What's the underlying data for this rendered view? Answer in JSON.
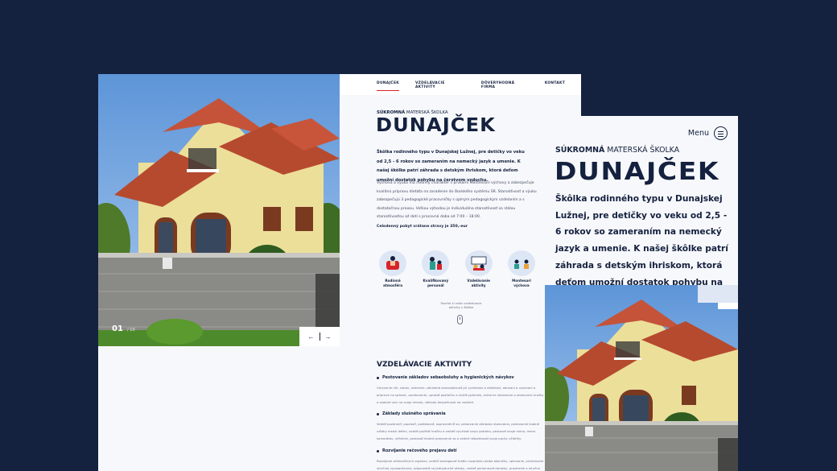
{
  "desktop": {
    "nav": [
      "DUNAJČEK",
      "VZDELÁVACIE AKTIVITY",
      "DÔVERYHODNÁ FIRMA",
      "KONTAKT"
    ],
    "slider": {
      "current": "01",
      "total": "/ 10"
    },
    "subtitle_bold": "SÚKROMNÁ",
    "subtitle_rest": " MATERSKÁ ŠKOLKA",
    "title": "DUNAJČEK",
    "lead": "Škôlka rodinného typu v Dunajskej Lužnej, pre detičky vo veku od 2,5 - 6 rokov so zameraním na nemecký jazyk a umenie. K našej škôlke patrí záhrada s detským ihriskom, ktorá deťom umožní dostatok pohybu na čerstvom vzduchu.",
    "body": "Výchova a výuka má rodinný charakter s prvkami Montessori výchovy a zabezpečuje kvalitnú prípravu dieťaťa na zaradenie do školského systému SR. Starostlivosť a výuku zabezpečujú 3 pedagogické pracovníčky s úplným pedagogickým vzdelaním a s dostatočnou praxou. Veľkou výhodou je individuálna starostlivosť so stálou starostlivosťou až deti s pracovná doba od 7:00 – 18:00.",
    "price": "Celodenný pobyt vrátane stravy je 350,-eur",
    "features": [
      {
        "icon": "armchair-child-icon",
        "label": "Rodinná atmosféra"
      },
      {
        "icon": "teacher-child-icon",
        "label": "Kvalifikovaný personál"
      },
      {
        "icon": "classroom-icon",
        "label": "Vzdelávanie aktivity"
      },
      {
        "icon": "yoga-children-icon",
        "label": "Montesori výchova"
      }
    ],
    "scroll_hint": "Pozrite si naše vzdelávacie aktivity v škôlke",
    "activities_title": "VZDELÁVACIE AKTIVITY",
    "activities": [
      {
        "title": "Pestovanie základov sebaobsluhy a hygienických návykov",
        "desc": "Umývanie rúk, zubov, utieranie, základná samostatnosť pri vyzliekaní a obliekaní, obúvaní a vyzúvaní a príprave na spánok, upratovanie, upratať postieľku a uložiť pyžamko, kultúrne stolovanie a stolovanie hračky a osobné veci na svoje miesto, základy bezpečnosti na cestách."
      },
      {
        "title": "Základy slušného správania",
        "desc": "Vedieť pozdraviť, poprosiť, poďakovať, ospravedlniť sa, pestovanie základov stolovania, pestovanie kladné vzťahy medzi deťmi, vedieť požičať hračku a vedieť využívať svoju potrebu, pestovať svoje meno, meno kamarátov, učiteliek, pestovať kladné prejavenie sa a vedieť rešpektovať svoje pocity učiteľky."
      },
      {
        "title": "Rozvíjanie rečového prejavu detí",
        "desc": "Rozvíjanie artikulačných orgánov, vedieť zareagovať krátku rozprávku alebo básničku, spievanie, pretváranie stručnej vyrozprávania, odpovedať na jednoduché otázky, vedieť pomenovať obrázky, prostredie a stručne opísať."
      }
    ]
  },
  "mobile": {
    "menu_label": "Menu",
    "subtitle_bold": "SÚKROMNÁ",
    "subtitle_rest": " MATERSKÁ ŠKOLKA",
    "title": "DUNAJČEK",
    "lead": "Škôlka rodinného typu v Dunajskej Lužnej, pre detičky vo veku od 2,5 - 6 rokov so zameraním na nemecký jazyk a umenie. K našej škôlke patrí záhrada s detským ihriskom, ktorá deťom umožní dostatok pohybu na čerstvom vzduchu."
  },
  "colors": {
    "background": "#14213f",
    "navy": "#14213f",
    "accent_red": "#d8232a",
    "pale_blue": "#dfe6f4"
  }
}
